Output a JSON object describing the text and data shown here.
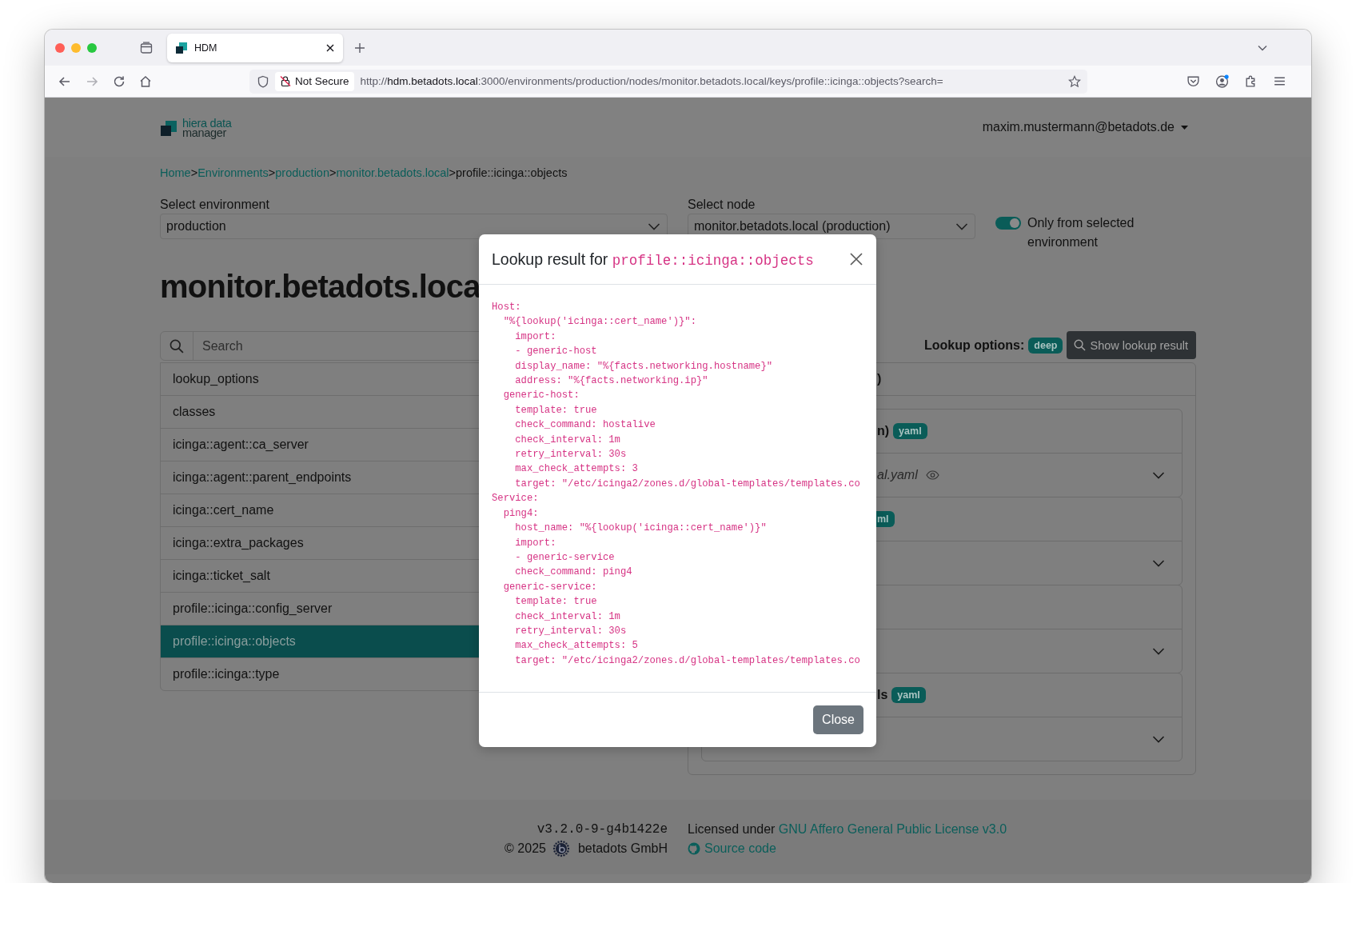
{
  "browser": {
    "tabs": [
      {
        "title": "HDM",
        "selected": true
      }
    ],
    "address_bar": {
      "security": "Not Secure",
      "url": "http://**hdm.betadots.local**:3000/environments/production/nodes/monitor.betadots.local/keys/profile::icinga::objects?search="
    }
  },
  "header": {
    "logo": {
      "line_1": "hiera data",
      "line_2": "manager"
    },
    "user_menu": "maxim.mustermann@betadots.de"
  },
  "breadcrumb": [
    {
      "label": "Home",
      "kind": "link"
    },
    {
      "label": ">",
      "kind": "separator"
    },
    {
      "label": "Environments",
      "kind": "link"
    },
    {
      "label": ">",
      "kind": "separator"
    },
    {
      "label": "production",
      "kind": "link"
    },
    {
      "label": ">",
      "kind": "separator"
    },
    {
      "label": "monitor.betadots.local",
      "kind": "link"
    },
    {
      "label": ">",
      "kind": "separator"
    },
    {
      "label": "profile::icinga::objects",
      "kind": "current"
    }
  ],
  "filters": {
    "environment": {
      "label": "Select environment",
      "value": "production"
    },
    "node": {
      "label": "Select node",
      "value": "monitor.betadots.local (production)"
    },
    "only_selected_environment": {
      "label": "Only from selected environment",
      "on": true
    }
  },
  "page_title": "monitor.betadots.loca",
  "keys": {
    "search": {
      "placeholder": "Search"
    },
    "items": [
      {
        "name": "lookup_options",
        "selected": false
      },
      {
        "name": "classes",
        "selected": false
      },
      {
        "name": "icinga::agent::ca_server",
        "selected": false
      },
      {
        "name": "icinga::agent::parent_endpoints",
        "selected": false
      },
      {
        "name": "icinga::cert_name",
        "selected": false
      },
      {
        "name": "icinga::extra_packages",
        "selected": false
      },
      {
        "name": "icinga::ticket_salt",
        "selected": false
      },
      {
        "name": "profile::icinga::config_server",
        "selected": false
      },
      {
        "name": "profile::icinga::objects",
        "selected": true
      },
      {
        "name": "profile::icinga::type",
        "selected": false
      }
    ]
  },
  "lookup": {
    "label": "Lookup options:",
    "badge": "deep",
    "button": "Show lookup result"
  },
  "hierarchy": {
    "header": ")",
    "levels": [
      {
        "title": "n)",
        "badge": "yaml",
        "file": "al.yaml",
        "expanded": false
      },
      {
        "badge": "ml",
        "expanded": false
      },
      {
        "expanded": false
      },
      {
        "title": "ls",
        "badge": "yaml",
        "expanded": false
      }
    ]
  },
  "modal": {
    "title": "Lookup result for",
    "key": "profile::icinga::objects",
    "code": [
      "Host:",
      "  \"%{lookup('icinga::cert_name')}\":",
      "    import:",
      "    - generic-host",
      "    display_name: \"%{facts.networking.hostname}\"",
      "    address: \"%{facts.networking.ip}\"",
      "  generic-host:",
      "    template: true",
      "    check_command: hostalive",
      "    check_interval: 1m",
      "    retry_interval: 30s",
      "    max_check_attempts: 3",
      "    target: \"/etc/icinga2/zones.d/global-templates/templates.co",
      "Service:",
      "  ping4:",
      "    host_name: \"%{lookup('icinga::cert_name')}\"",
      "    import:",
      "    - generic-service",
      "    check_command: ping4",
      "  generic-service:",
      "    template: true",
      "    check_interval: 1m",
      "    retry_interval: 30s",
      "    max_check_attempts: 5",
      "    target: \"/etc/icinga2/zones.d/global-templates/templates.co"
    ],
    "button": "Close"
  },
  "footer": {
    "version": "v3.2.0-9-g4b1422e",
    "copyright": "© 2025",
    "company": "betadots GmbH",
    "license_text": "Licensed under",
    "license_link": "GNU Affero General Public License v3.0",
    "source_link": "Source code"
  }
}
